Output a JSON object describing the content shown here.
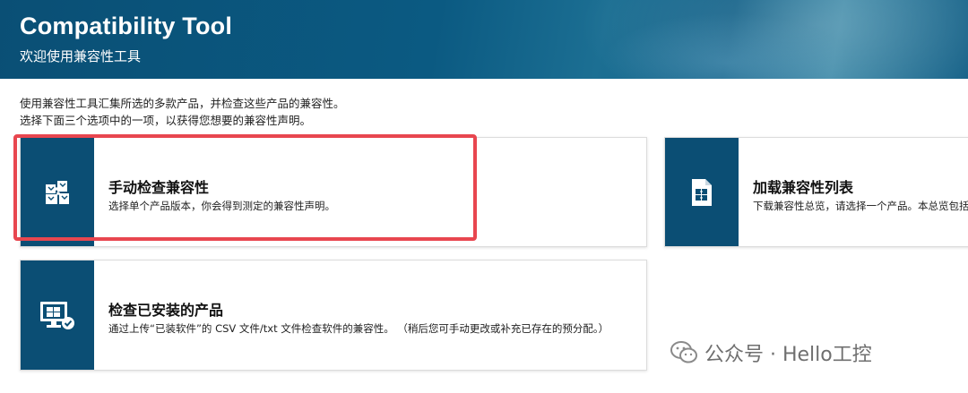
{
  "header": {
    "title": "Compatibility Tool",
    "subtitle": "欢迎使用兼容性工具"
  },
  "intro": {
    "line1": "使用兼容性工具汇集所选的多款产品，并检查这些产品的兼容性。",
    "line2": "选择下面三个选项中的一项，以获得您想要的兼容性声明。"
  },
  "options": [
    {
      "title": "手动检查兼容性",
      "description": "选择单个产品版本，你会得到测定的兼容性声明。",
      "icon": "puzzle-icon"
    },
    {
      "title": "加载兼容性列表",
      "description": "下载兼容性总览，请选择一个产品。本总览包括",
      "icon": "document-puzzle-icon"
    },
    {
      "title": "检查已安装的产品",
      "description": "通过上传“已装软件”的 CSV 文件/txt 文件检查软件的兼容性。 （稍后您可手动更改或补充已存在的预分配。）",
      "icon": "monitor-check-icon"
    }
  ],
  "watermark": {
    "text": "公众号 · Hello工控",
    "icon": "wechat-icon"
  },
  "colors": {
    "header_blue": "#0b5a82",
    "icon_box_blue": "#0b4e74",
    "highlight_red": "#e8464f"
  }
}
